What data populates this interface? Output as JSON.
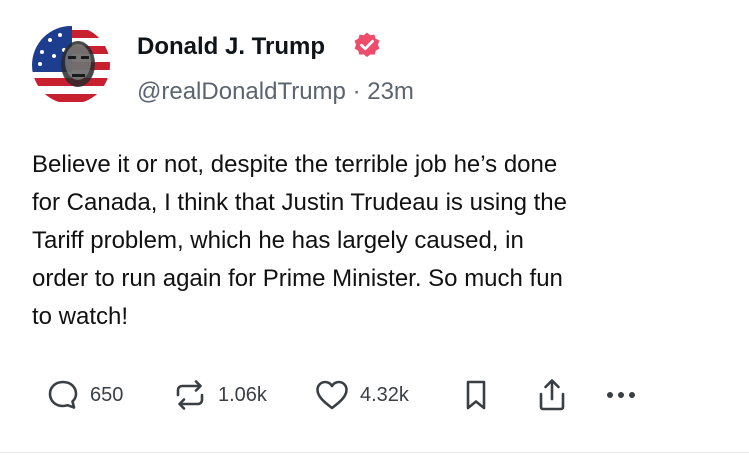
{
  "author": {
    "name": "Donald J. Trump",
    "handle": "@realDonaldTrump",
    "separator": "·",
    "time": "23m"
  },
  "post": {
    "lines": [
      "Believe it or not, despite the terrible job he’s done",
      "for Canada, I think that Justin Trudeau is using the",
      "Tariff problem, which he has largely caused, in",
      "order to run again for Prime Minister. So much fun",
      "to watch!"
    ]
  },
  "actions": {
    "replies": "650",
    "reposts": "1.06k",
    "likes": "4.32k"
  },
  "icons": {
    "verified": "verified-badge-icon",
    "reply": "comment-bubble-icon",
    "repost": "repost-arrows-icon",
    "like": "heart-icon",
    "bookmark": "bookmark-icon",
    "share": "share-upload-icon",
    "more": "more-dots-icon"
  },
  "colors": {
    "verified_badge": "#ef4b6a",
    "text": "#0f1419",
    "secondary_text": "#5b6470",
    "icon": "#3a3f44"
  }
}
